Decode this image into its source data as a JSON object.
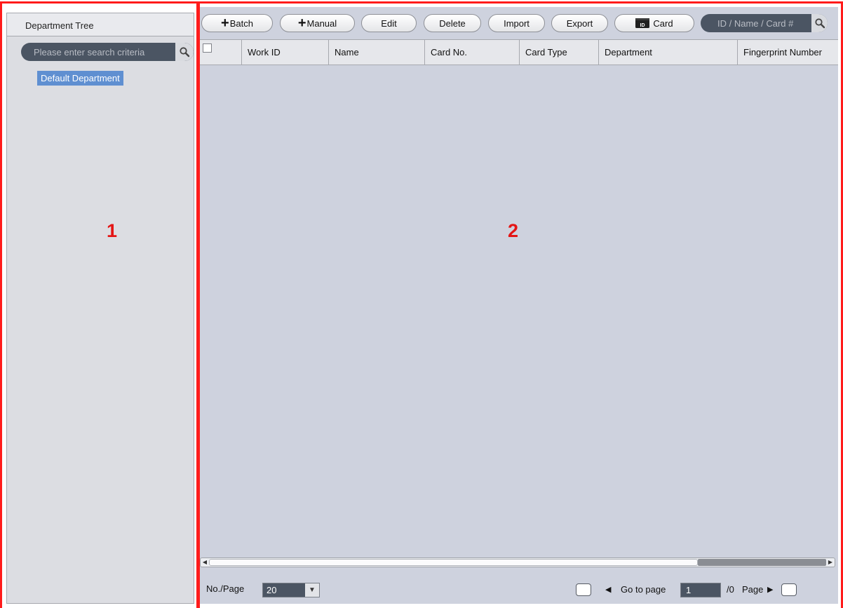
{
  "left_panel": {
    "title": "Department Tree",
    "search_placeholder": "Please enter search criteria",
    "tree": [
      {
        "label": "Default Department",
        "selected": true
      }
    ]
  },
  "toolbar": {
    "batch_label": "Batch",
    "manual_label": "Manual",
    "edit_label": "Edit",
    "delete_label": "Delete",
    "import_label": "Import",
    "export_label": "Export",
    "card_label": "Card",
    "card_icon_text": "ID",
    "search_placeholder": "ID / Name / Card #"
  },
  "table": {
    "columns": [
      "Work ID",
      "Name",
      "Card No.",
      "Card Type",
      "Department",
      "Fingerprint Number"
    ],
    "rows": []
  },
  "pagination": {
    "per_page_label": "No./Page",
    "per_page_value": "20",
    "goto_label": "Go to page",
    "current_page": "1",
    "total_pages": "/0",
    "page_label": "Page"
  },
  "annotations": {
    "region_1": "1",
    "region_2": "2"
  },
  "colors": {
    "annotation_red": "#ff1b1b",
    "selected_node": "#5f8fd1",
    "panel_bg": "#ced2de",
    "search_field_bg": "#4b5563"
  }
}
